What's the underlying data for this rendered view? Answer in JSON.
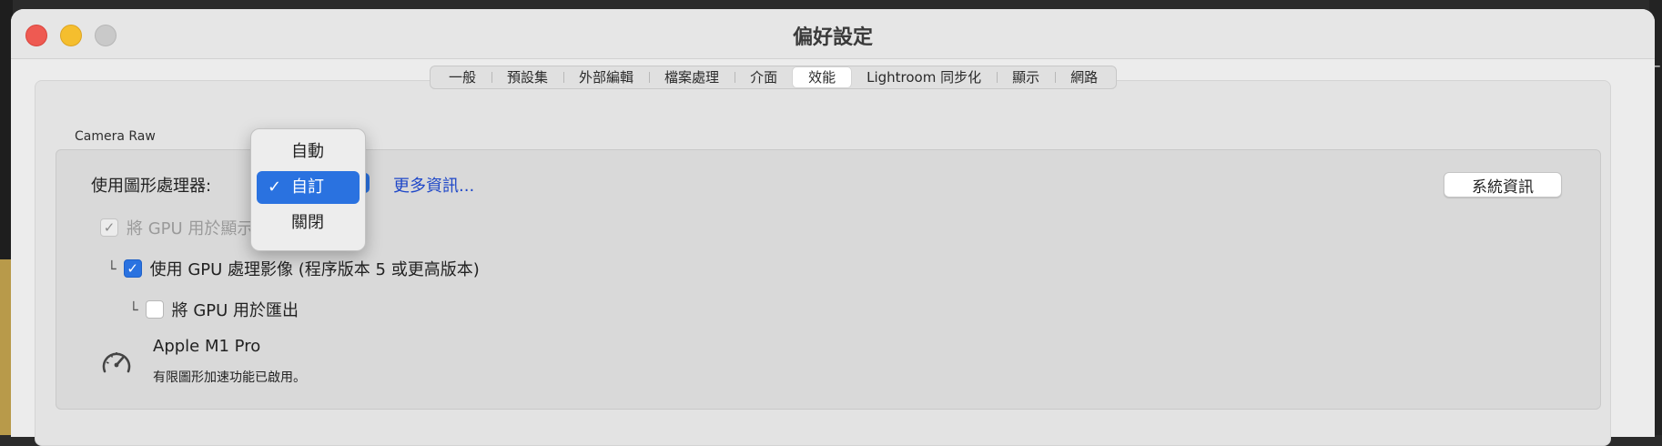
{
  "window": {
    "title": "偏好設定"
  },
  "tabs": [
    {
      "label": "一般"
    },
    {
      "label": "預設集"
    },
    {
      "label": "外部編輯"
    },
    {
      "label": "檔案處理"
    },
    {
      "label": "介面"
    },
    {
      "label": "效能",
      "active": true
    },
    {
      "label": "Lightroom 同步化"
    },
    {
      "label": "顯示"
    },
    {
      "label": "網路"
    }
  ],
  "section": {
    "title": "Camera Raw",
    "gpu_label": "使用圖形處理器:",
    "gpu_selected": "自訂",
    "more_info": "更多資訊...",
    "system_info_button": "系統資訊",
    "options": [
      {
        "label": "將 GPU 用於顯示",
        "checked": true,
        "disabled": true
      },
      {
        "label": "使用 GPU 處理影像 (程序版本 5 或更高版本)",
        "checked": true
      },
      {
        "label": "將 GPU 用於匯出",
        "checked": false
      }
    ],
    "gpu_name": "Apple M1 Pro",
    "gpu_status": "有限圖形加速功能已啟用。"
  },
  "dropdown": {
    "items": [
      "自動",
      "自訂",
      "關閉"
    ],
    "selected_index": 1,
    "check_glyph": "✓"
  },
  "icons": {
    "gauge": "speedometer-icon",
    "check": "checkmark-icon"
  },
  "colors": {
    "accent": "#2a72e0",
    "link": "#1e47c8",
    "close": "#ee5a52",
    "minimize": "#f5be2e",
    "zoom": "#c9c9c9"
  }
}
